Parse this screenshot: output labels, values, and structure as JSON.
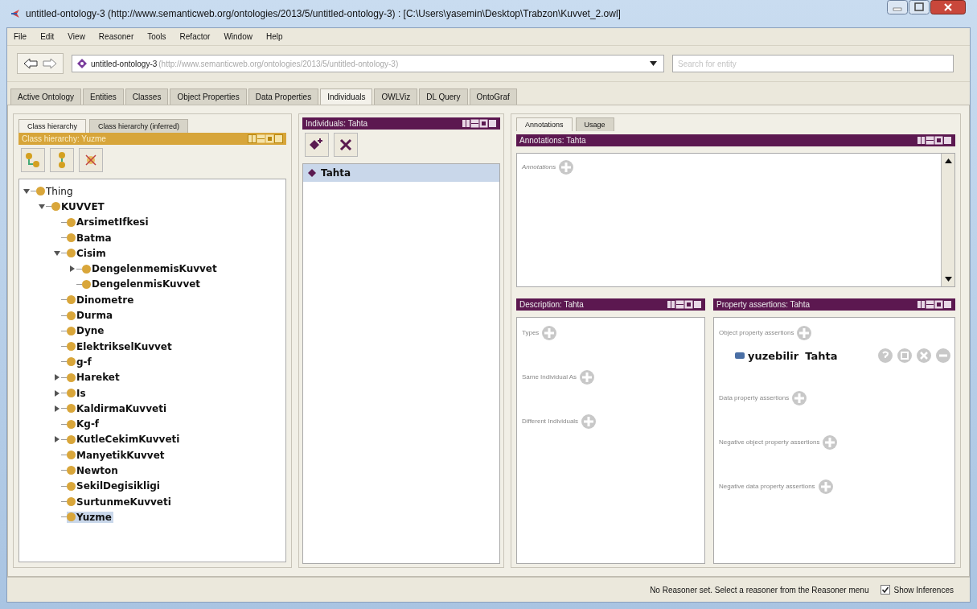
{
  "window": {
    "title": "untitled-ontology-3 (http://www.semanticweb.org/ontologies/2013/5/untitled-ontology-3) : [C:\\Users\\yasemin\\Desktop\\Trabzon\\Kuvvet_2.owl]"
  },
  "menu": [
    "File",
    "Edit",
    "View",
    "Reasoner",
    "Tools",
    "Refactor",
    "Window",
    "Help"
  ],
  "toolbar": {
    "ontology": {
      "name": "untitled-ontology-3",
      "iri": "(http://www.semanticweb.org/ontologies/2013/5/untitled-ontology-3)"
    },
    "search": {
      "placeholder": "Search for entity"
    }
  },
  "tabs": [
    {
      "label": "Active Ontology",
      "selected": false
    },
    {
      "label": "Entities",
      "selected": false
    },
    {
      "label": "Classes",
      "selected": false
    },
    {
      "label": "Object Properties",
      "selected": false
    },
    {
      "label": "Data Properties",
      "selected": false
    },
    {
      "label": "Individuals",
      "selected": true
    },
    {
      "label": "OWLViz",
      "selected": false
    },
    {
      "label": "DL Query",
      "selected": false
    },
    {
      "label": "OntoGraf",
      "selected": false
    }
  ],
  "class_panel": {
    "tabs": [
      {
        "label": "Class hierarchy",
        "selected": true
      },
      {
        "label": "Class hierarchy (inferred)",
        "selected": false
      }
    ],
    "header": "Class hierarchy: Yuzme",
    "tree": [
      {
        "label": "Thing",
        "expanded": true,
        "selected": false,
        "children": [
          {
            "label": "KUVVET",
            "expanded": true,
            "selected": false,
            "children": [
              {
                "label": "ArsimetIfkesi",
                "selected": false
              },
              {
                "label": "Batma",
                "selected": false
              },
              {
                "label": "Cisim",
                "expanded": true,
                "selected": false,
                "children": [
                  {
                    "label": "DengelenmemisKuvvet",
                    "expanded": false,
                    "selected": false
                  },
                  {
                    "label": "DengelenmisKuvvet",
                    "selected": false
                  }
                ]
              },
              {
                "label": "Dinometre",
                "selected": false
              },
              {
                "label": "Durma",
                "selected": false
              },
              {
                "label": "Dyne",
                "selected": false
              },
              {
                "label": "ElektrikselKuvvet",
                "selected": false
              },
              {
                "label": "g-f",
                "selected": false
              },
              {
                "label": "Hareket",
                "expanded": false,
                "selected": false
              },
              {
                "label": "Is",
                "expanded": false,
                "selected": false
              },
              {
                "label": "KaldirmaKuvveti",
                "expanded": false,
                "selected": false
              },
              {
                "label": "Kg-f",
                "selected": false
              },
              {
                "label": "KutleCekimKuvveti",
                "expanded": false,
                "selected": false
              },
              {
                "label": "ManyetikKuvvet",
                "selected": false
              },
              {
                "label": "Newton",
                "selected": false
              },
              {
                "label": "SekilDegisikligi",
                "selected": false
              },
              {
                "label": "SurtunmeKuvveti",
                "selected": false
              },
              {
                "label": "Yuzme",
                "selected": true
              }
            ]
          }
        ]
      }
    ]
  },
  "individuals_panel": {
    "header": "Individuals: Tahta",
    "items": [
      {
        "label": "Tahta",
        "selected": true
      }
    ]
  },
  "annotations_panel": {
    "tabs": [
      {
        "label": "Annotations",
        "selected": true
      },
      {
        "label": "Usage",
        "selected": false
      }
    ],
    "header": "Annotations: Tahta",
    "section": "Annotations"
  },
  "description_panel": {
    "header": "Description: Tahta",
    "sections": [
      {
        "label": "Types"
      },
      {
        "label": "Same Individual As"
      },
      {
        "label": "Different Individuals"
      }
    ]
  },
  "property_panel": {
    "header": "Property assertions: Tahta",
    "sections": [
      {
        "label": "Object property assertions",
        "entries": [
          {
            "property": "yuzebilir",
            "value": "Tahta"
          }
        ]
      },
      {
        "label": "Data property assertions"
      },
      {
        "label": "Negative object property assertions"
      },
      {
        "label": "Negative data property assertions"
      }
    ]
  },
  "status_bar": {
    "message": "No Reasoner set. Select a reasoner from the Reasoner menu",
    "show_inferences": {
      "label": "Show Inferences",
      "checked": true
    }
  }
}
